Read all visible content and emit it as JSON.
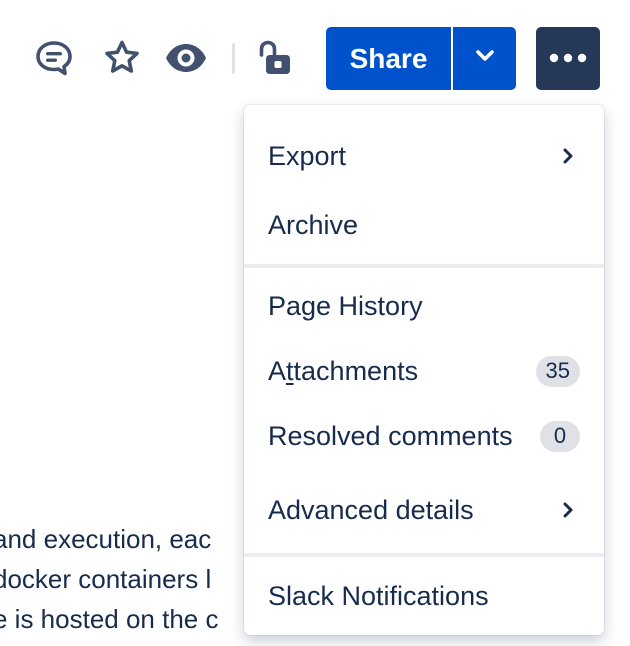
{
  "toolbar": {
    "icons": {
      "comment": "comment-icon",
      "star": "star-icon",
      "watch": "eye-icon",
      "restrictions": "unlock-icon"
    },
    "share_label": "Share",
    "share_dropdown_icon": "chevron-down-icon",
    "more_icon": "more-horizontal-icon"
  },
  "page_text": {
    "lines": [
      "and execution, eac",
      "docker containers l",
      "e is hosted on the c"
    ]
  },
  "menu": {
    "sections": [
      {
        "items": [
          {
            "label": "Export",
            "submenu": true
          },
          {
            "label": "Archive"
          }
        ]
      },
      {
        "items": [
          {
            "label_parts": [
              "A",
              "t",
              "tachments"
            ],
            "label": "Attachments",
            "badge": "35"
          },
          {
            "label": "Page History"
          },
          {
            "label": "Resolved comments",
            "badge": "0"
          },
          {
            "label": "Advanced details",
            "submenu": true
          }
        ]
      },
      {
        "items": [
          {
            "label": "Slack Notifications"
          }
        ]
      }
    ]
  },
  "colors": {
    "primary": "#0052CC",
    "more_button": "#253858",
    "text": "#172B4D",
    "icon": "#42526E",
    "badge_bg": "#DFE1E6",
    "separator": "#EBECF0"
  }
}
